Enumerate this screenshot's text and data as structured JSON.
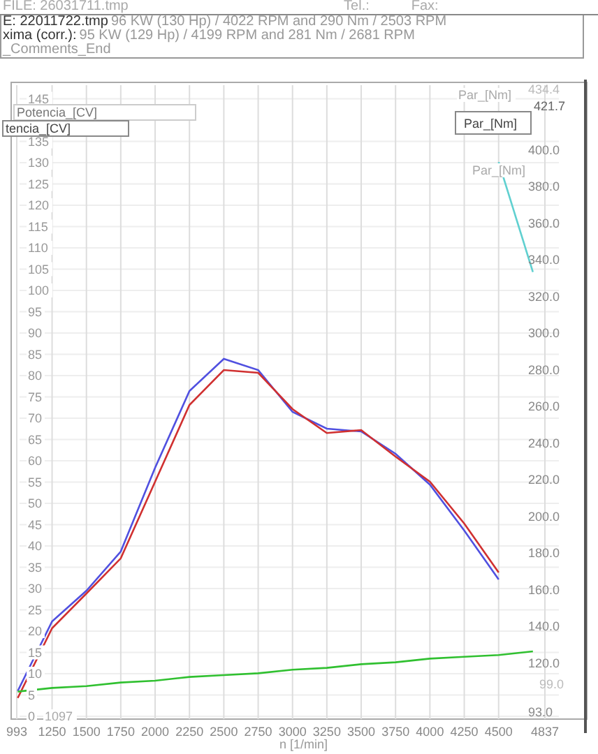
{
  "header": {
    "file": "FILE: 26031711.tmp",
    "tel": "Tel.:",
    "fax": "Fax:",
    "lines": [
      {
        "label": "E: 22011722.tmp",
        "text": "96 KW (130 Hp) / 4022 RPM  and  290 Nm /  2503 RPM"
      },
      {
        "label": "xima (corr.):",
        "text": "95 KW (129 Hp) / 4199 RPM  and  281 Nm / 2681 RPM"
      }
    ],
    "comment": "_Comments_End"
  },
  "chart": {
    "legend_left": [
      "Potencia_[CV]",
      "tencia_[CV]"
    ],
    "legend_right": [
      "Par_[Nm]",
      "Par_[Nm]",
      "Par_[Nm]"
    ],
    "left_axis_ticks": [
      "145",
      "135",
      "130",
      "125",
      "120",
      "115",
      "110",
      "105",
      "100",
      "95",
      "90",
      "85",
      "80",
      "75",
      "70",
      "65",
      "60",
      "55",
      "50",
      "45",
      "40",
      "35",
      "30",
      "25",
      "20",
      "15",
      "10",
      "5",
      "0"
    ],
    "right_axis_extra": [
      "434.4",
      "421.7",
      "99.0",
      "93.0"
    ],
    "x_extra": "1097",
    "chart_data": {
      "type": "line",
      "xlabel": "n [1/min]",
      "grid": true,
      "x": [
        1000,
        1250,
        1500,
        1750,
        2000,
        2250,
        2500,
        2750,
        3000,
        3250,
        3500,
        3750,
        4000,
        4250,
        4500,
        4750
      ],
      "xlim": [
        993,
        4837
      ],
      "xticks": [
        {
          "value": 993,
          "label": "993"
        },
        1250,
        1500,
        1750,
        2000,
        2250,
        2500,
        2750,
        3000,
        3250,
        3500,
        3750,
        4000,
        4250,
        4500,
        {
          "value": 4837,
          "label": "4837"
        }
      ],
      "ylim": [
        93,
        434.4
      ],
      "yticks": [
        {
          "value": 120,
          "label": "120.0"
        },
        {
          "value": 140,
          "label": "140.0"
        },
        {
          "value": 160,
          "label": "160.0"
        },
        {
          "value": 180,
          "label": "180.0"
        },
        {
          "value": 200,
          "label": "200.0"
        },
        {
          "value": 220,
          "label": "220.0"
        },
        {
          "value": 240,
          "label": "240.0"
        },
        {
          "value": 260,
          "label": "260.0"
        },
        {
          "value": 280,
          "label": "280.0"
        },
        {
          "value": 300,
          "label": "300.0"
        },
        {
          "value": 320,
          "label": "320.0"
        },
        {
          "value": 340,
          "label": "340.0"
        },
        {
          "value": 360,
          "label": "360.0"
        },
        {
          "value": 380,
          "label": "380.0"
        },
        {
          "value": 400,
          "label": "400.0"
        }
      ],
      "series": [
        {
          "color": "#5050e0",
          "values": [
            106.3,
            144.4,
            161.1,
            182.5,
            228.2,
            270.1,
            287.6,
            281.5,
            258.7,
            249.5,
            248,
            235.8,
            219,
            193.9,
            167.2,
            null
          ]
        },
        {
          "color": "#d03030",
          "values": [
            102.5,
            140.6,
            159.6,
            178.7,
            220.6,
            262.5,
            281.5,
            280,
            260.2,
            247.2,
            248.8,
            234.3,
            220.6,
            197.7,
            171,
            null
          ]
        },
        {
          "color": "#30c030",
          "values": [
            106,
            108,
            109,
            111,
            112,
            114,
            115,
            116,
            118,
            119,
            121,
            122,
            124,
            125,
            126,
            128
          ]
        },
        {
          "color": "#60d0d0",
          "values": [
            null,
            null,
            null,
            null,
            null,
            null,
            null,
            null,
            null,
            null,
            null,
            null,
            null,
            null,
            395,
            335
          ]
        }
      ]
    }
  }
}
